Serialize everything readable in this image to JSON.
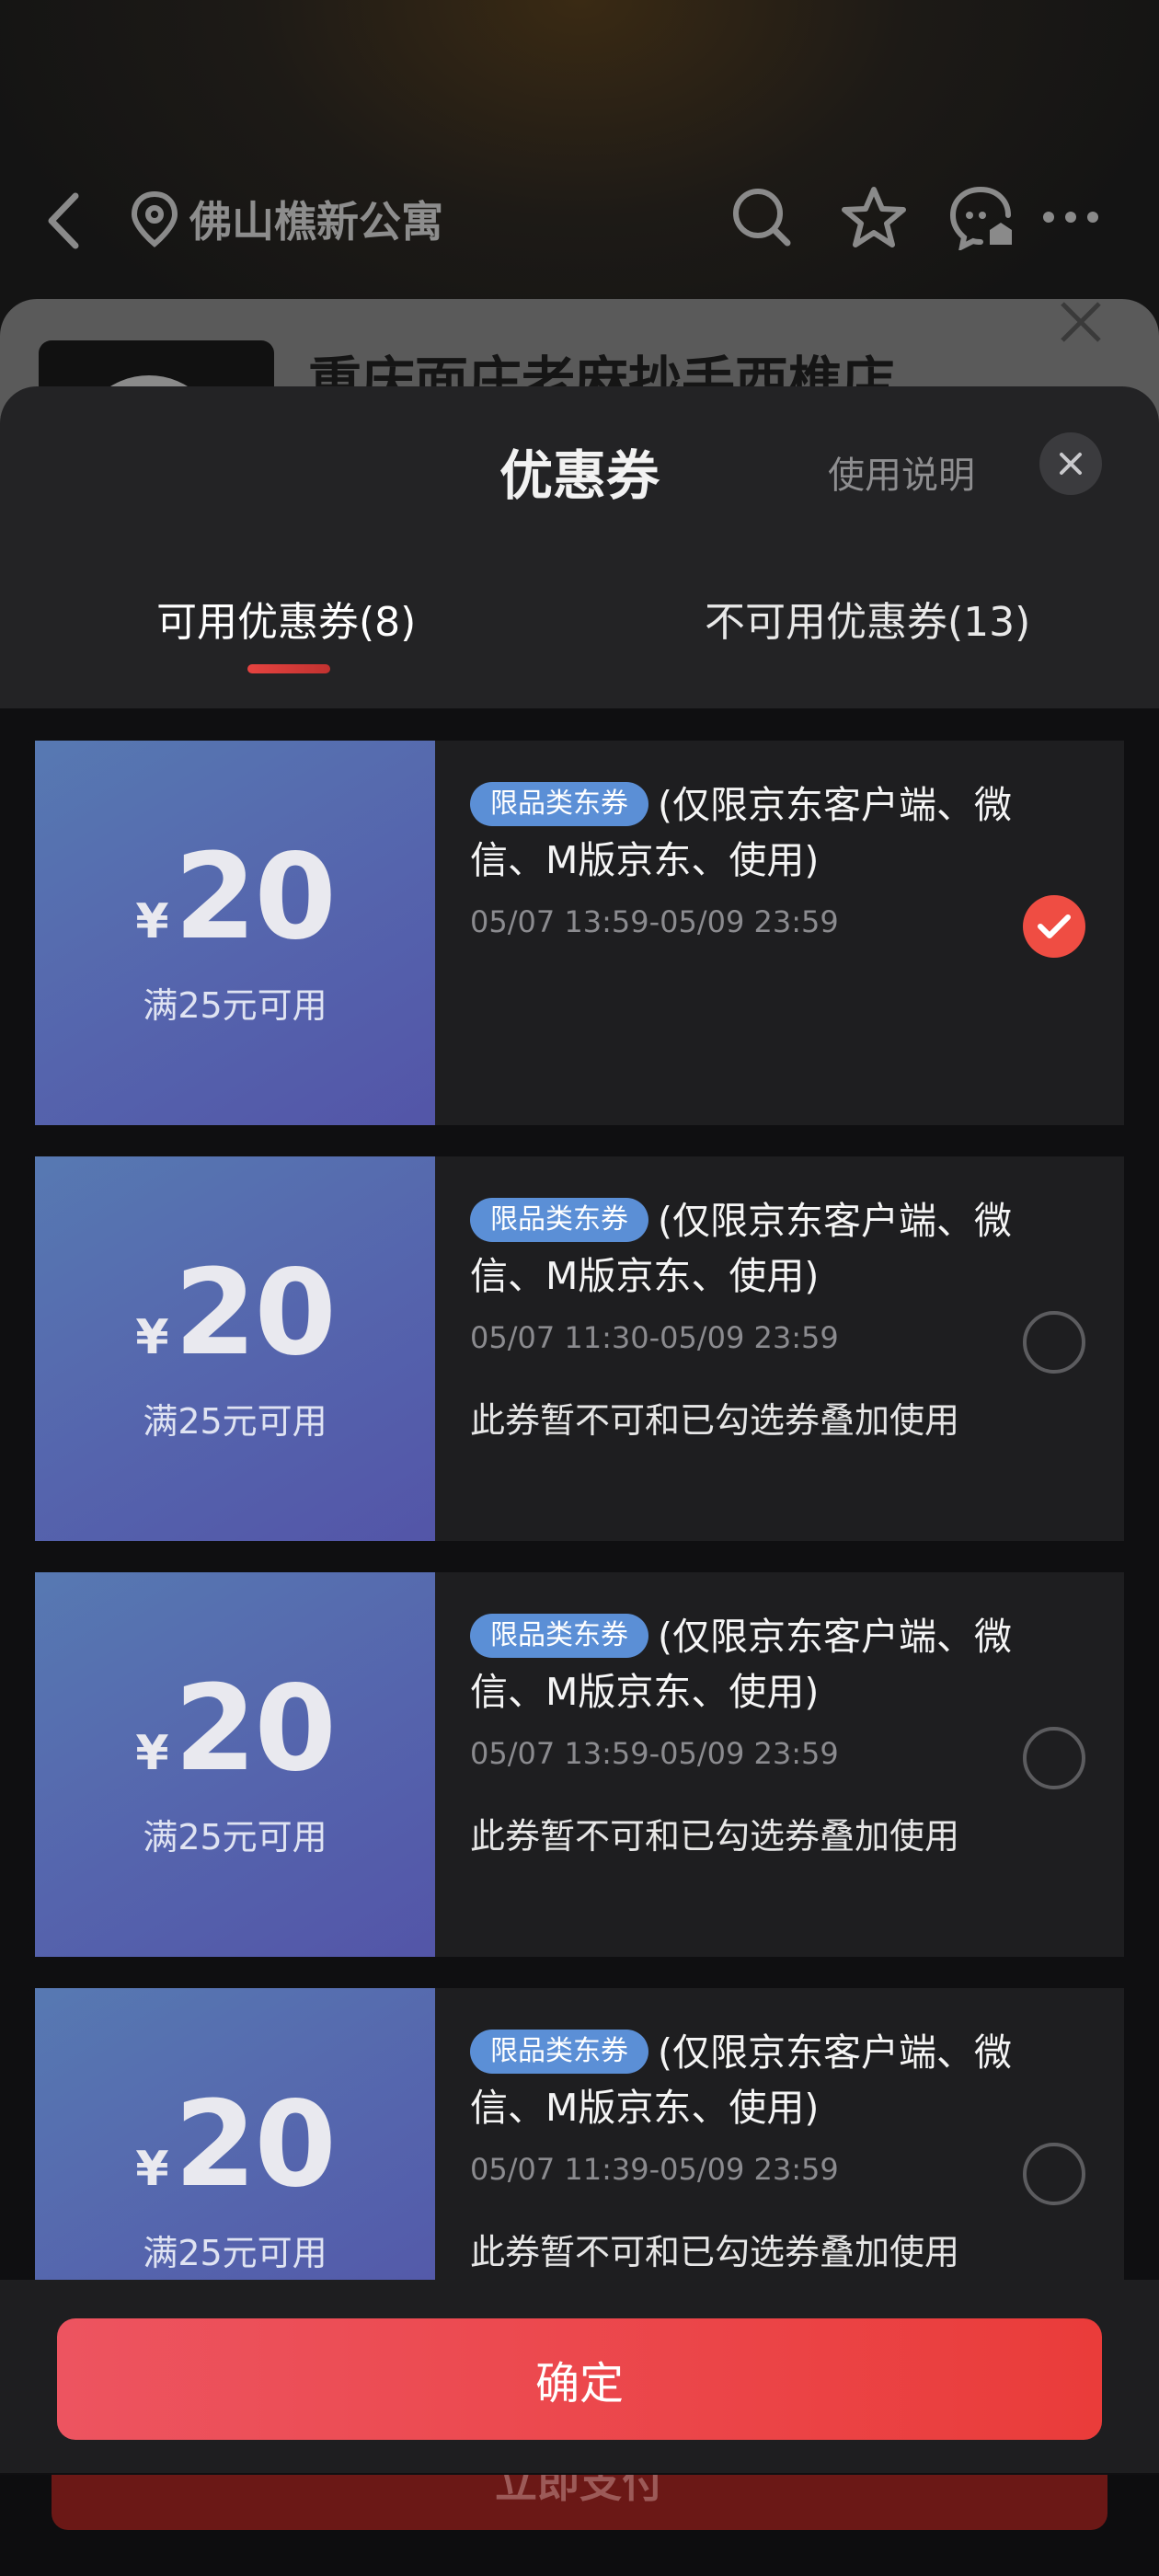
{
  "background": {
    "location": "佛山樵新公寓",
    "shop_title": "重庆面庄老麻抄手西樵店",
    "bottom_button": "立即支付"
  },
  "sheet": {
    "title": "优惠券",
    "help_link": "使用说明",
    "tabs": [
      {
        "label": "可用优惠券(8)",
        "active": true
      },
      {
        "label": "不可用优惠券(13)",
        "active": false
      }
    ],
    "coupons": [
      {
        "currency": "¥",
        "amount": "20",
        "condition": "满25元可用",
        "tag": "限品类东券",
        "description": "(仅限京东客户端、微信、M版京东、使用)",
        "period": "05/07 13:59-05/09 23:59",
        "note": "",
        "selected": true
      },
      {
        "currency": "¥",
        "amount": "20",
        "condition": "满25元可用",
        "tag": "限品类东券",
        "description": "(仅限京东客户端、微信、M版京东、使用)",
        "period": "05/07 11:30-05/09 23:59",
        "note": "此券暂不可和已勾选券叠加使用",
        "selected": false
      },
      {
        "currency": "¥",
        "amount": "20",
        "condition": "满25元可用",
        "tag": "限品类东券",
        "description": "(仅限京东客户端、微信、M版京东、使用)",
        "period": "05/07 13:59-05/09 23:59",
        "note": "此券暂不可和已勾选券叠加使用",
        "selected": false
      },
      {
        "currency": "¥",
        "amount": "20",
        "condition": "满25元可用",
        "tag": "限品类东券",
        "description": "(仅限京东客户端、微信、M版京东、使用)",
        "period": "05/07 11:39-05/09 23:59",
        "note": "此券暂不可和已勾选券叠加使用",
        "selected": false
      }
    ],
    "confirm_label": "确定"
  },
  "colors": {
    "accent": "#EA3C3A",
    "coupon_blue": "#5564AD",
    "tag_blue": "#5B8FD6"
  },
  "icons": [
    "back-arrow-icon",
    "location-pin-icon",
    "search-icon",
    "star-icon",
    "message-icon",
    "more-icon",
    "close-icon",
    "check-icon"
  ]
}
